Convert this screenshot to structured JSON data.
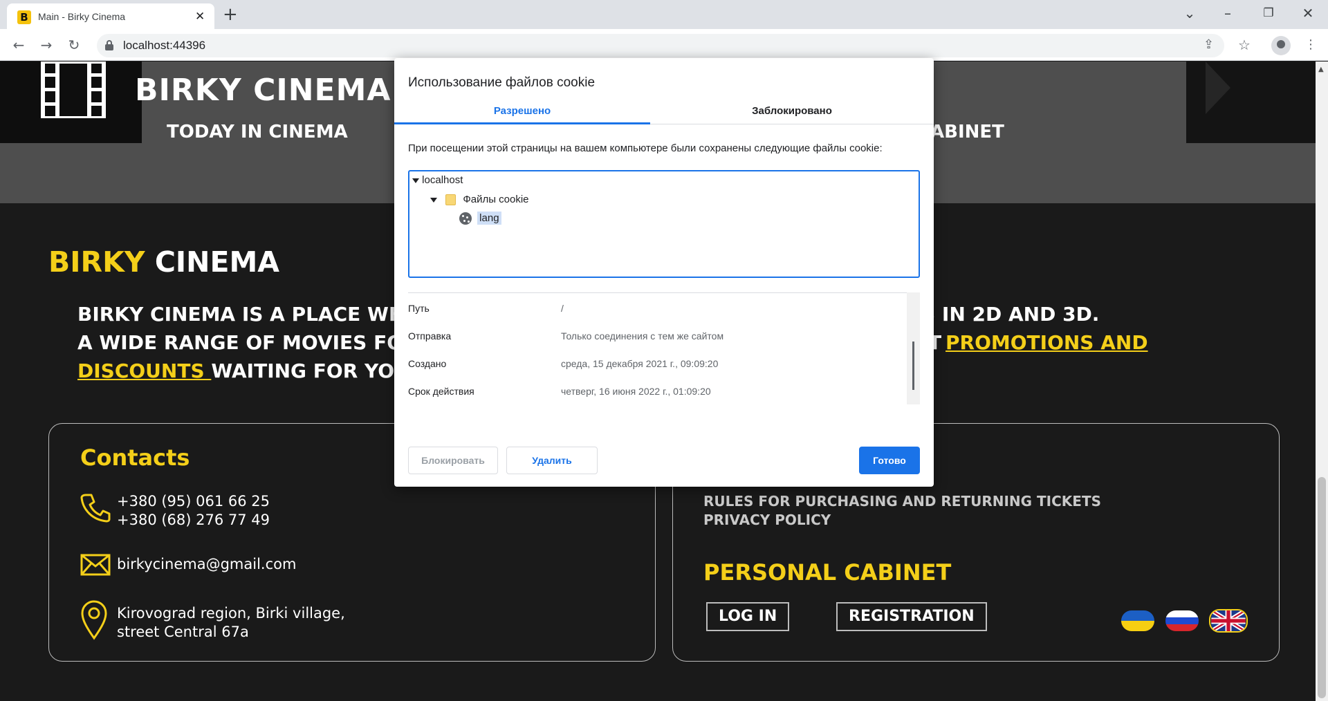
{
  "browser": {
    "tab_title": "Main - Birky Cinema",
    "tab_favicon": "B",
    "new_tab_icon": "plus-icon",
    "url": "localhost:44396"
  },
  "site": {
    "title": "BIRKY CINEMA",
    "nav_today": "TODAY IN CINEMA",
    "nav_cabinet_partial": "ABINET",
    "about_title_accent": "BIRKY",
    "about_title_rest": " CINEMA",
    "about_line1_start": "BIRKY CINEMA IS A PLACE WHER",
    "about_line1_end": "S IN 2D AND 3D.",
    "about_line2_start": "A WIDE RANGE OF MOVIES FOR ",
    "about_line2_end": "T ",
    "about_promo_link": "PROMOTIONS AND",
    "about_promo_link2": "DISCOUNTS ",
    "about_line3_end": "WAITING FOR YOU.",
    "accent_color": "#f4cf19"
  },
  "contacts": {
    "title": "Contacts",
    "phone1": "+380 (95) 061 66 25",
    "phone2": "+380 (68) 276 77 49",
    "email": "birkycinema@gmail.com",
    "address1": "Kirovograd region, Birki village,",
    "address2": "street Central 67a"
  },
  "links": {
    "rules": "RULES FOR PURCHASING AND RETURNING TICKETS",
    "privacy": "PRIVACY POLICY",
    "cabinet_title": "PERSONAL CABINET",
    "login": "LOG IN",
    "registration": "REGISTRATION"
  },
  "cookie_dialog": {
    "title": "Использование файлов cookie",
    "tab_allowed": "Разрешено",
    "tab_blocked": "Заблокировано",
    "description": "При посещении этой страницы на вашем компьютере были сохранены следующие файлы cookie:",
    "tree": {
      "host": "localhost",
      "folder": "Файлы cookie",
      "cookie": "lang"
    },
    "details": [
      {
        "label": "Путь",
        "value": "/"
      },
      {
        "label": "Отправка",
        "value": "Только соединения с тем же сайтом"
      },
      {
        "label": "Создано",
        "value": "среда, 15 декабря 2021 г., 09:09:20"
      },
      {
        "label": "Срок действия",
        "value": "четверг, 16 июня 2022 г., 01:09:20"
      }
    ],
    "block_button": "Блокировать",
    "delete_button": "Удалить",
    "done_button": "Готово",
    "accent_color": "#1a73e8"
  }
}
